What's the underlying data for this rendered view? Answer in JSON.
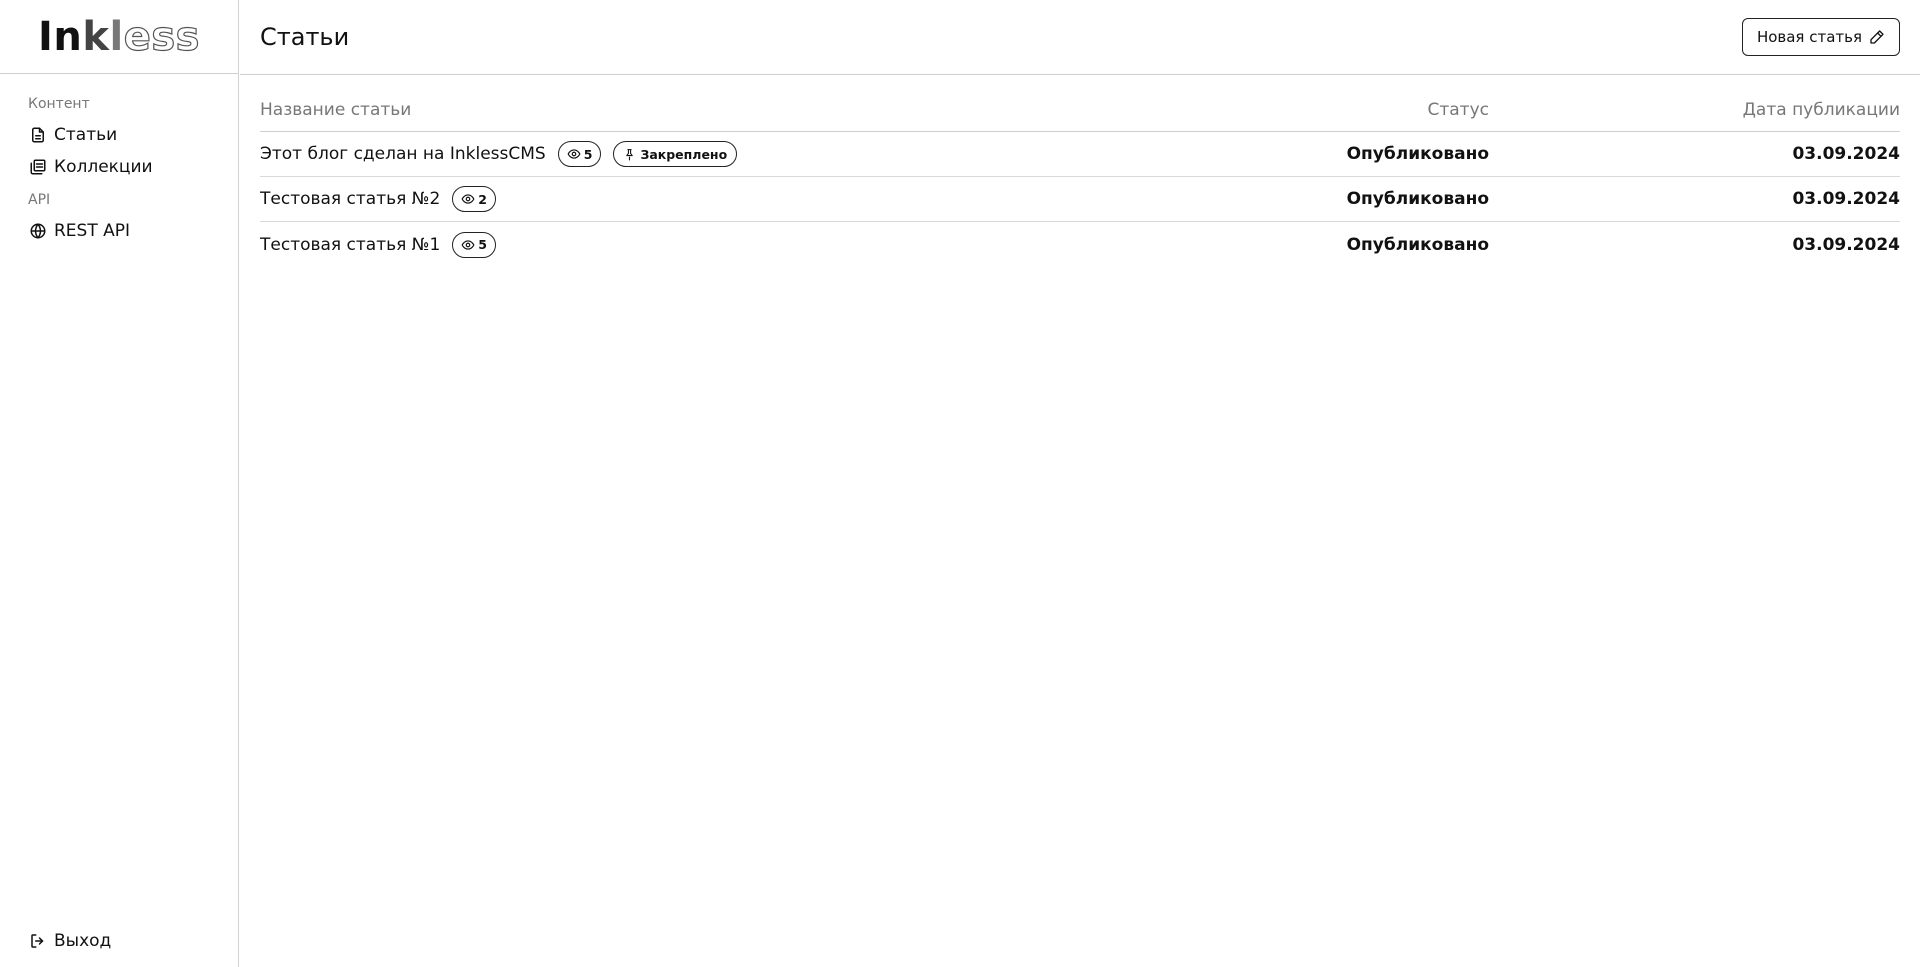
{
  "app": {
    "logo": "Inkless"
  },
  "sidebar": {
    "sections": [
      {
        "label": "Контент",
        "items": [
          {
            "label": "Статьи",
            "icon": "document-icon"
          },
          {
            "label": "Коллекции",
            "icon": "collections-icon"
          }
        ]
      },
      {
        "label": "API",
        "items": [
          {
            "label": "REST API",
            "icon": "globe-icon"
          }
        ]
      }
    ],
    "logout_label": "Выход"
  },
  "header": {
    "title": "Статьи",
    "new_button_label": "Новая статья"
  },
  "table": {
    "columns": {
      "title": "Название статьи",
      "status": "Статус",
      "date": "Дата публикации"
    },
    "rows": [
      {
        "title": "Этот блог сделан на InklessCMS",
        "views": "5",
        "pinned_label": "Закреплено",
        "status": "Опубликовано",
        "date": "03.09.2024"
      },
      {
        "title": "Тестовая статья №2",
        "views": "2",
        "status": "Опубликовано",
        "date": "03.09.2024"
      },
      {
        "title": "Тестовая статья №1",
        "views": "5",
        "status": "Опубликовано",
        "date": "03.09.2024"
      }
    ]
  }
}
